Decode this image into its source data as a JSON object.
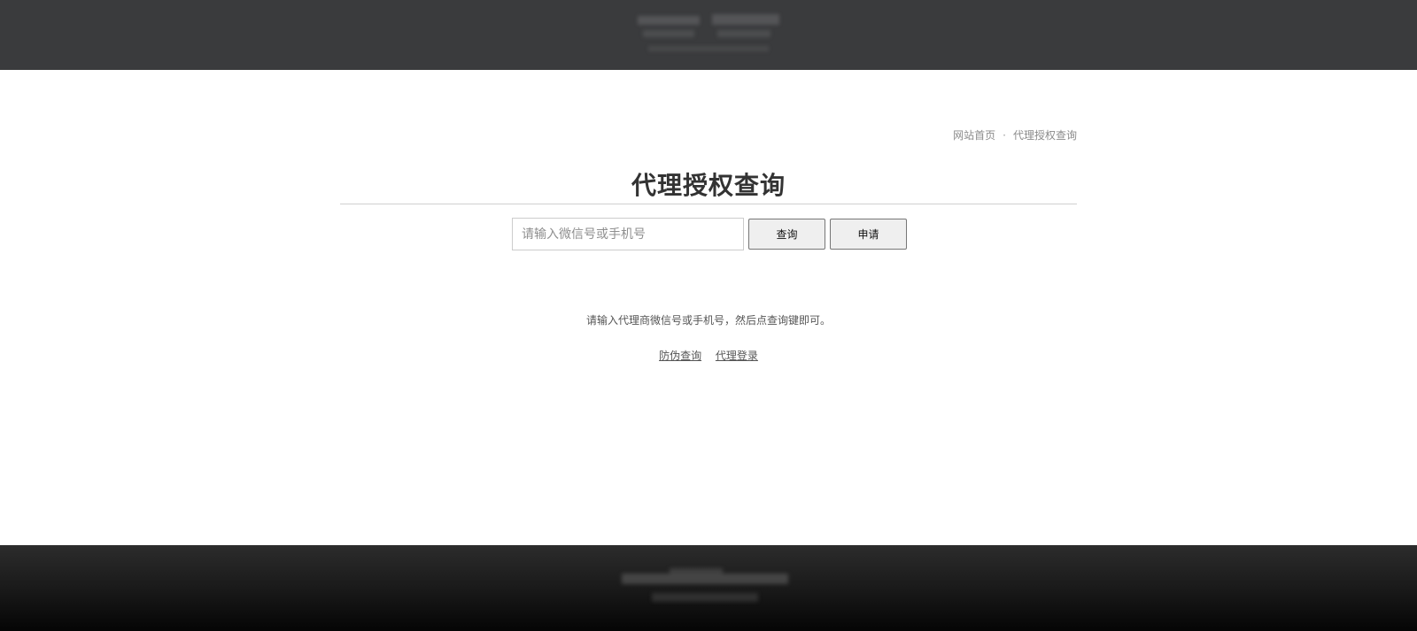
{
  "breadcrumb": {
    "home": "网站首页",
    "separator": "·",
    "current": "代理授权查询"
  },
  "page": {
    "title": "代理授权查询"
  },
  "search": {
    "placeholder": "请输入微信号或手机号",
    "value": "",
    "query_label": "查询",
    "apply_label": "申请"
  },
  "hint": "请输入代理商微信号或手机号，然后点查询键即可。",
  "links": {
    "anti_fake": "防伪查询",
    "agent_login": "代理登录"
  },
  "colors": {
    "header_bg": "#3a3b3d",
    "footer_bg": "#1a1a1a",
    "divider": "#cfcfcf"
  },
  "icons": {
    "header_logo": "blurred-logo-icon",
    "footer_logo": "blurred-footer-logo-icon"
  }
}
